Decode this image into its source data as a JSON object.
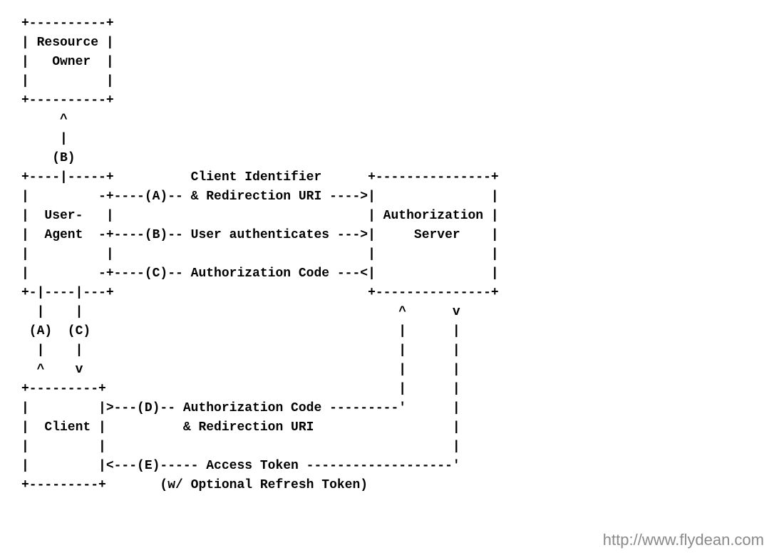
{
  "diagram": {
    "nodes": {
      "resource_owner": "Resource Owner",
      "user_agent": "User-Agent",
      "client": "Client",
      "authorization_server": "Authorization Server"
    },
    "flows": {
      "A": {
        "label": "(A)",
        "text": "Client Identifier & Redirection URI",
        "direction": "Client → User-Agent → Authorization Server"
      },
      "B": {
        "label": "(B)",
        "text": "User authenticates",
        "direction": "User-Agent ↔ Resource Owner / → Authorization Server"
      },
      "C": {
        "label": "(C)",
        "text": "Authorization Code",
        "direction": "Authorization Server → User-Agent → Client"
      },
      "D": {
        "label": "(D)",
        "text": "Authorization Code & Redirection URI",
        "direction": "Client → Authorization Server"
      },
      "E": {
        "label": "(E)",
        "text": "Access Token (w/ Optional Refresh Token)",
        "direction": "Authorization Server → Client"
      }
    },
    "ascii_lines": [
      "+----------+",
      "| Resource |",
      "|   Owner  |",
      "|          |",
      "+----------+",
      "     ^",
      "     |",
      "    (B)",
      "+----|-----+          Client Identifier      +---------------+",
      "|         -+----(A)-- & Redirection URI ---->|               |",
      "|  User-   |                                 | Authorization |",
      "|  Agent  -+----(B)-- User authenticates --->|     Server    |",
      "|          |                                 |               |",
      "|         -+----(C)-- Authorization Code ---<|               |",
      "+-|----|---+                                 +---------------+",
      "  |    |                                         ^      v",
      " (A)  (C)                                        |      |",
      "  |    |                                         |      |",
      "  ^    v                                         |      |",
      "+---------+                                      |      |",
      "|         |>---(D)-- Authorization Code ---------'      |",
      "|  Client |          & Redirection URI                  |",
      "|         |                                             |",
      "|         |<---(E)----- Access Token -------------------'",
      "+---------+       (w/ Optional Refresh Token)"
    ]
  },
  "watermark": "http://www.flydean.com"
}
